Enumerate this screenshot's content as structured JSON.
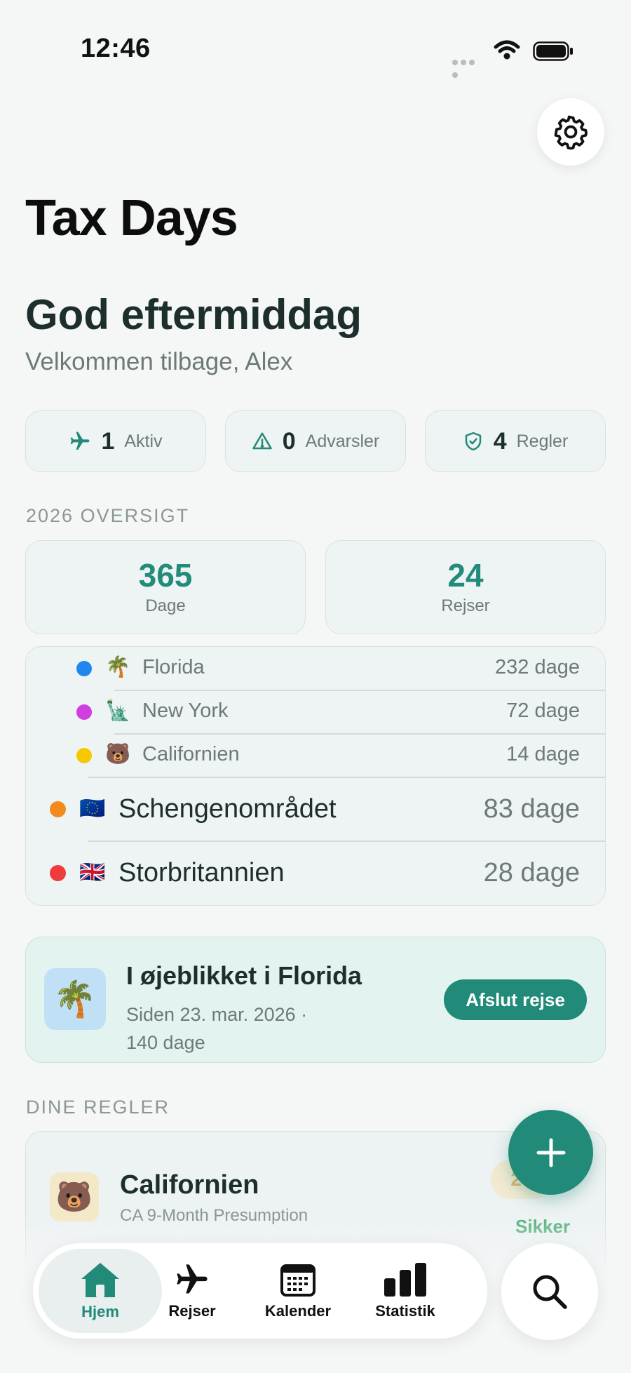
{
  "status_bar": {
    "time": "12:46"
  },
  "app_title": "Tax Days",
  "greeting": "God eftermiddag",
  "welcome": "Velkommen tilbage, Alex",
  "stats": [
    {
      "icon": "airplane-icon",
      "value": "1",
      "label": "Aktiv"
    },
    {
      "icon": "warning-icon",
      "value": "0",
      "label": "Advarsler"
    },
    {
      "icon": "shield-check-icon",
      "value": "4",
      "label": "Regler"
    }
  ],
  "overview": {
    "label": "2026 OVERSIGT",
    "days_value": "365",
    "days_label": "Dage",
    "trips_value": "24",
    "trips_label": "Rejser"
  },
  "regions": [
    {
      "name": "Florida",
      "days": "232 dage",
      "emoji": "🌴",
      "color": "#1e88f0"
    },
    {
      "name": "New York",
      "days": "72 dage",
      "emoji": "🗽",
      "color": "#d03de0"
    },
    {
      "name": "Californien",
      "days": "14 dage",
      "emoji": "🐻",
      "color": "#f5c800"
    },
    {
      "name": "Schengenområdet",
      "days": "83 dage",
      "emoji": "🇪🇺",
      "color": "#f28a1e"
    },
    {
      "name": "Storbritannien",
      "days": "28 dage",
      "emoji": "🇬🇧",
      "color": "#ee3b3b"
    }
  ],
  "current": {
    "emoji": "🌴",
    "title": "I øjeblikket i Florida",
    "subtitle": "Siden 23. mar. 2026 · 140 dage",
    "button": "Afslut rejse"
  },
  "rules": {
    "label": "DINE REGLER",
    "items": [
      {
        "emoji": "🐻",
        "title": "Californien",
        "subtitle": "CA 9-Month Presumption",
        "badge": "27",
        "status": "Sikker"
      }
    ]
  },
  "tabs": [
    {
      "label": "Hjem",
      "icon": "home-icon",
      "active": true
    },
    {
      "label": "Rejser",
      "icon": "airplane-icon"
    },
    {
      "label": "Kalender",
      "icon": "calendar-icon"
    },
    {
      "label": "Statistik",
      "icon": "bar-chart-icon"
    }
  ],
  "colors": {
    "accent": "#218a79",
    "background": "#f5f7f7",
    "safe": "#5db585"
  }
}
